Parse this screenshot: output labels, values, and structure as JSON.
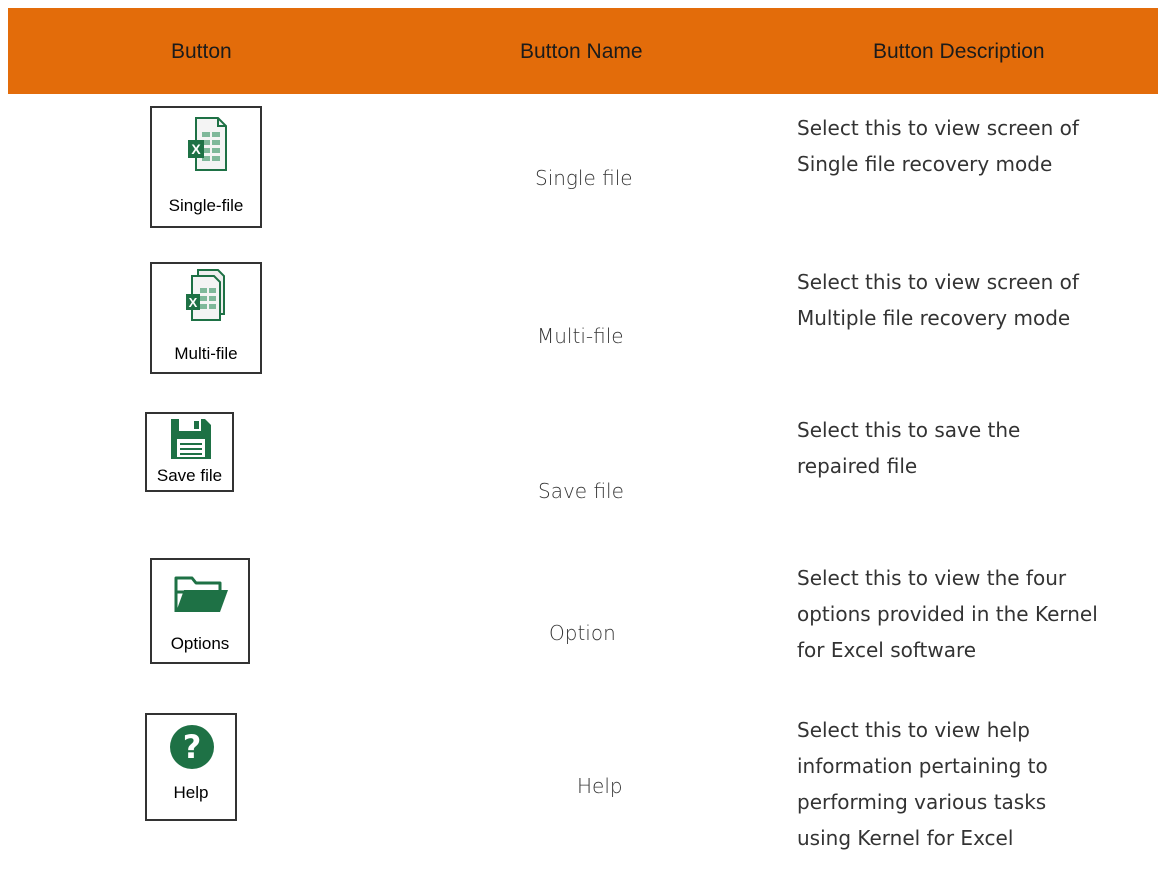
{
  "header": {
    "col1": "Button",
    "col2": "Button Name",
    "col3": "Button Description",
    "color": "#e36c0a"
  },
  "rows": [
    {
      "icon": "excel-single-file-icon",
      "icon_label": "Single-file",
      "name": "Single file",
      "desc_lines": [
        "Select this to view screen of",
        "Single file recovery mode"
      ]
    },
    {
      "icon": "excel-multi-file-icon",
      "icon_label": "Multi-file",
      "name": "Multi-file",
      "desc_lines": [
        "Select this to view screen of",
        "Multiple file recovery mode"
      ]
    },
    {
      "icon": "floppy-disk-icon",
      "icon_label": "Save file",
      "name": "Save file",
      "desc_lines": [
        "Select this to save the",
        "repaired file"
      ]
    },
    {
      "icon": "open-folder-icon",
      "icon_label": "Options",
      "name": "Option",
      "desc_lines": [
        "Select this to view the four",
        "options provided in the Kernel",
        "for Excel software"
      ]
    },
    {
      "icon": "help-question-icon",
      "icon_label": "Help",
      "name": "Help",
      "desc_lines": [
        "Select this to view help",
        "information pertaining to",
        "performing various tasks",
        "using Kernel for Excel"
      ]
    }
  ],
  "icon_color": "#1e7145"
}
